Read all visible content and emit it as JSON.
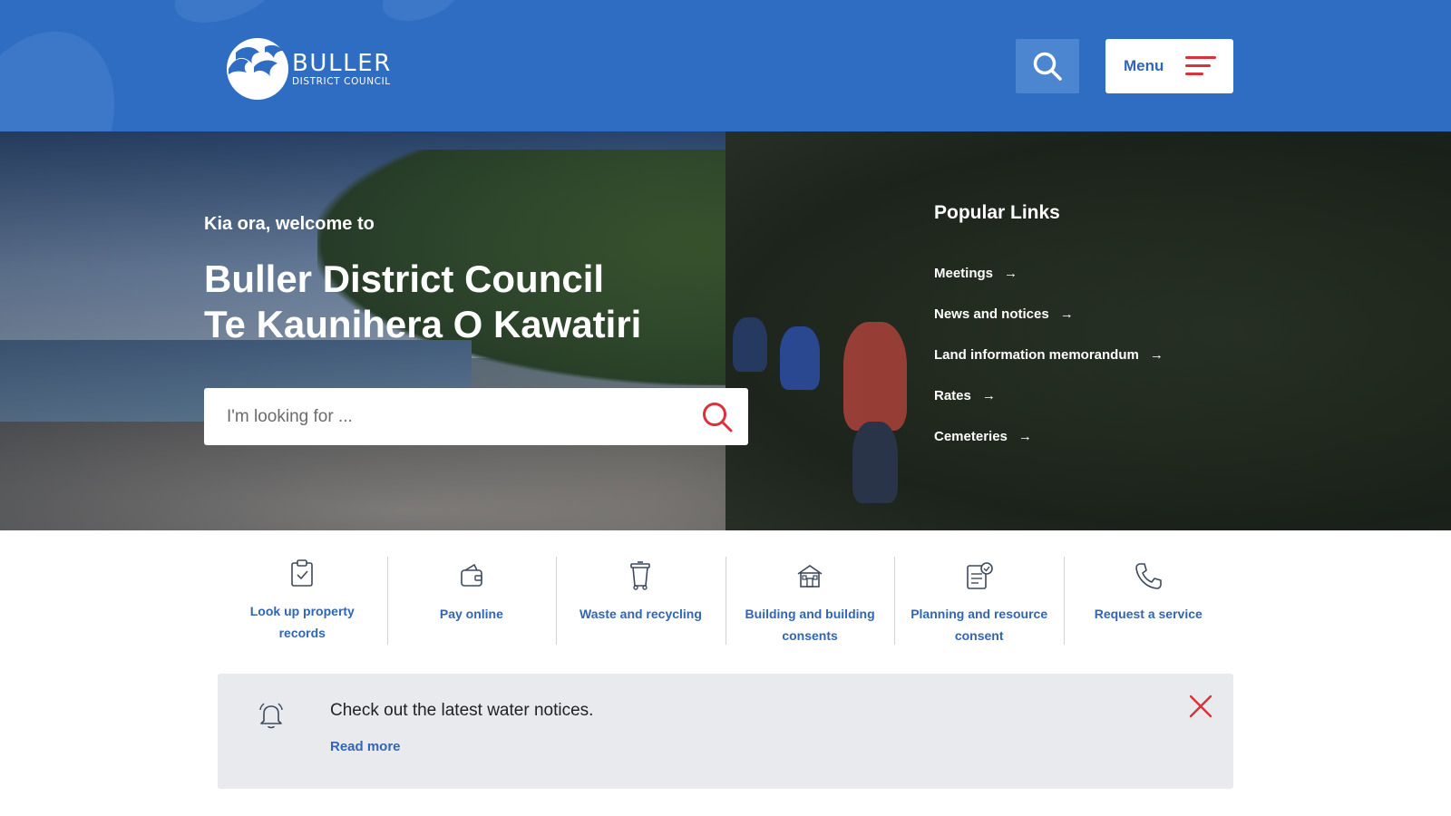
{
  "header": {
    "logo": {
      "line1": "BULLER",
      "line2": "DISTRICT COUNCIL"
    },
    "search_icon": "search-icon",
    "menu_label": "Menu"
  },
  "hero": {
    "welcome": "Kia ora, welcome to",
    "title_line1": "Buller District Council",
    "title_line2": "Te Kaunihera O Kawatiri",
    "search_placeholder": "I'm looking for ..."
  },
  "popular": {
    "heading": "Popular Links",
    "links": [
      {
        "label": "Meetings"
      },
      {
        "label": "News and notices"
      },
      {
        "label": "Land information memorandum"
      },
      {
        "label": "Rates"
      },
      {
        "label": "Cemeteries"
      }
    ]
  },
  "quick_links": [
    {
      "label": "Look up property records",
      "icon": "clipboard-check-icon"
    },
    {
      "label": "Pay online",
      "icon": "wallet-icon"
    },
    {
      "label": "Waste and recycling",
      "icon": "bin-icon"
    },
    {
      "label": "Building and building consents",
      "icon": "house-icon"
    },
    {
      "label": "Planning and resource consent",
      "icon": "document-check-icon"
    },
    {
      "label": "Request a service",
      "icon": "phone-icon"
    }
  ],
  "notice": {
    "message": "Check out the latest water notices.",
    "read_more": "Read more"
  },
  "colors": {
    "header_blue": "#2f6dc3",
    "link_blue": "#2f66b5",
    "accent_red": "#d9323a",
    "notice_bg": "#e8eaed"
  }
}
